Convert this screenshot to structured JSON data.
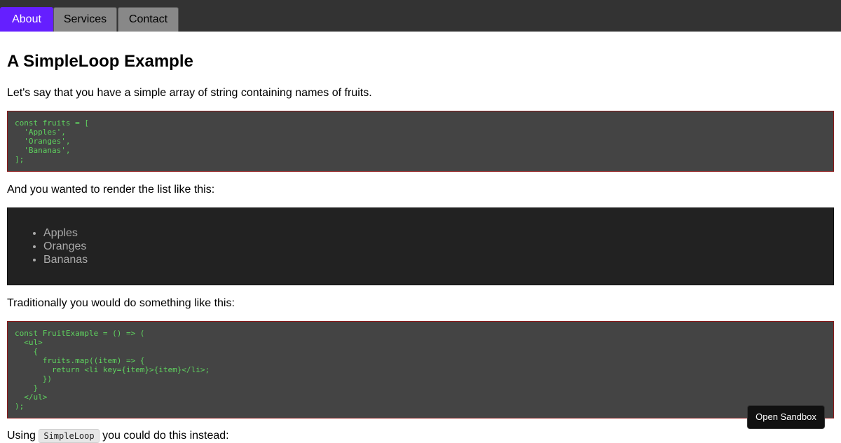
{
  "nav": {
    "tabs": [
      {
        "label": "About",
        "active": true
      },
      {
        "label": "Services",
        "active": false
      },
      {
        "label": "Contact",
        "active": false
      }
    ]
  },
  "main": {
    "title": "A SimpleLoop Example",
    "intro": "Let's say that you have a simple array of string containing names of fruits.",
    "code1": "const fruits = [\n  'Apples',\n  'Oranges',\n  'Bananas',\n];",
    "render_intro": "And you wanted to render the list like this:",
    "fruits": [
      "Apples",
      "Oranges",
      "Bananas"
    ],
    "traditional_intro": "Traditionally you would do something like this:",
    "code2": "const FruitExample = () => (\n  <ul>\n    {\n      fruits.map((item) => {\n        return <li key={item}>{item}</li>;\n      })\n    }\n  </ul>\n);",
    "using_prefix": "Using",
    "using_code": "SimpleLoop",
    "using_suffix": "you could do this instead:"
  },
  "sandbox": {
    "label": "Open Sandbox"
  },
  "colors": {
    "accent": "#651fff",
    "code_text": "#5fd35f",
    "code_bg": "#444444",
    "code_border": "#8b1a1a",
    "nav_bg": "#333333"
  }
}
